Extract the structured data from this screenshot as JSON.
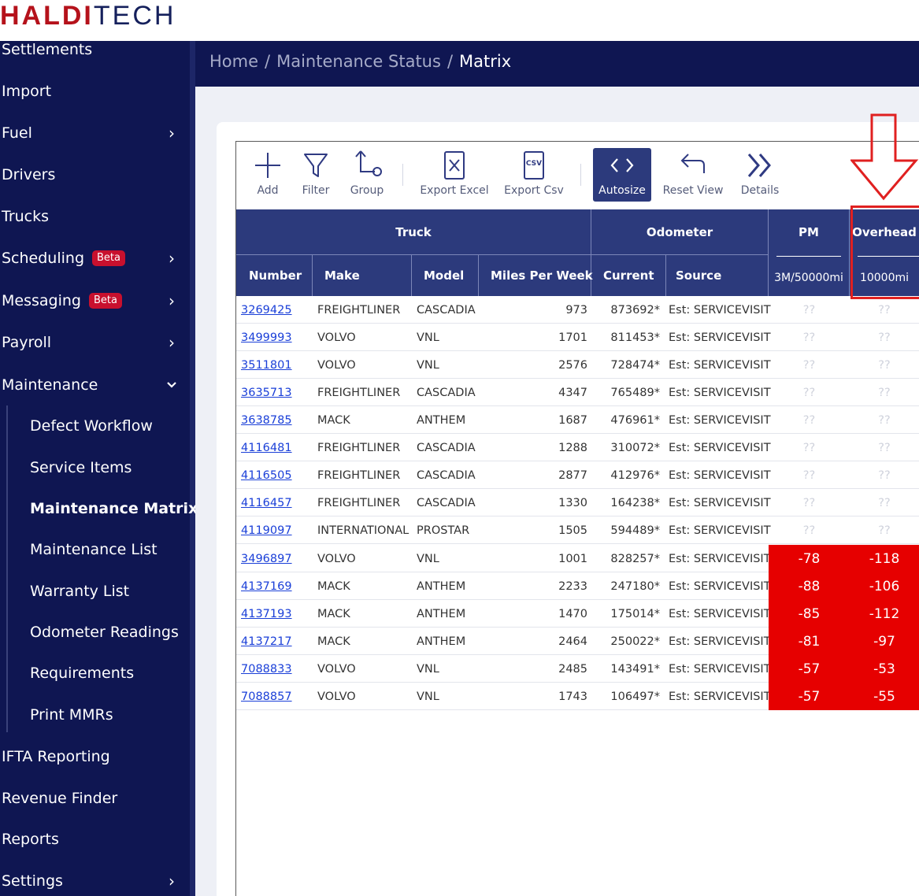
{
  "logo": {
    "part1": "HALDI",
    "part2": "TECH"
  },
  "sidebar": {
    "items": [
      {
        "label": "Settlements",
        "chevron": ""
      },
      {
        "label": "Import",
        "chevron": ""
      },
      {
        "label": "Fuel",
        "chevron": "›"
      },
      {
        "label": "Drivers",
        "chevron": ""
      },
      {
        "label": "Trucks",
        "chevron": ""
      },
      {
        "label": "Scheduling",
        "badge": "Beta",
        "chevron": "›"
      },
      {
        "label": "Messaging",
        "badge": "Beta",
        "chevron": "›"
      },
      {
        "label": "Payroll",
        "chevron": "›"
      },
      {
        "label": "Maintenance",
        "chevron": "⌄"
      }
    ],
    "sub_items": [
      {
        "label": "Defect Workflow"
      },
      {
        "label": "Service Items"
      },
      {
        "label": "Maintenance Matrix",
        "active": true
      },
      {
        "label": "Maintenance List"
      },
      {
        "label": "Warranty List"
      },
      {
        "label": "Odometer Readings"
      },
      {
        "label": "Requirements"
      },
      {
        "label": "Print MMRs"
      }
    ],
    "bottom_items": [
      {
        "label": "IFTA Reporting",
        "chevron": ""
      },
      {
        "label": "Revenue Finder",
        "chevron": ""
      },
      {
        "label": "Reports",
        "chevron": ""
      },
      {
        "label": "Settings",
        "chevron": "›"
      }
    ]
  },
  "breadcrumb": {
    "home": "Home",
    "sep": "/",
    "status": "Maintenance Status",
    "current": "Matrix"
  },
  "toolbar": {
    "add": "Add",
    "filter": "Filter",
    "group": "Group",
    "export_excel": "Export Excel",
    "export_csv": "Export Csv",
    "autosize": "Autosize",
    "reset_view": "Reset View",
    "details": "Details",
    "csv_icon_text": "CSV"
  },
  "table": {
    "groups": {
      "truck": "Truck",
      "odometer": "Odometer",
      "pm": "PM",
      "overhead": "Overhead"
    },
    "columns": {
      "number": "Number",
      "make": "Make",
      "model": "Model",
      "mpw": "Miles Per Week",
      "current": "Current",
      "source": "Source",
      "pm_sub": "3M/50000mi",
      "overhead_sub": "10000mi"
    },
    "rows": [
      {
        "number": "3269425",
        "make": "FREIGHTLINER",
        "model": "CASCADIA",
        "mpw": "973",
        "current": "873692*",
        "source": "Est: SERVICEVISIT",
        "pm": "??",
        "overhead": "??",
        "alert": false
      },
      {
        "number": "3499993",
        "make": "VOLVO",
        "model": "VNL",
        "mpw": "1701",
        "current": "811453*",
        "source": "Est: SERVICEVISIT",
        "pm": "??",
        "overhead": "??",
        "alert": false
      },
      {
        "number": "3511801",
        "make": "VOLVO",
        "model": "VNL",
        "mpw": "2576",
        "current": "728474*",
        "source": "Est: SERVICEVISIT",
        "pm": "??",
        "overhead": "??",
        "alert": false
      },
      {
        "number": "3635713",
        "make": "FREIGHTLINER",
        "model": "CASCADIA",
        "mpw": "4347",
        "current": "765489*",
        "source": "Est: SERVICEVISIT",
        "pm": "??",
        "overhead": "??",
        "alert": false
      },
      {
        "number": "3638785",
        "make": "MACK",
        "model": "ANTHEM",
        "mpw": "1687",
        "current": "476961*",
        "source": "Est: SERVICEVISIT",
        "pm": "??",
        "overhead": "??",
        "alert": false
      },
      {
        "number": "4116481",
        "make": "FREIGHTLINER",
        "model": "CASCADIA",
        "mpw": "1288",
        "current": "310072*",
        "source": "Est: SERVICEVISIT",
        "pm": "??",
        "overhead": "??",
        "alert": false
      },
      {
        "number": "4116505",
        "make": "FREIGHTLINER",
        "model": "CASCADIA",
        "mpw": "2877",
        "current": "412976*",
        "source": "Est: SERVICEVISIT",
        "pm": "??",
        "overhead": "??",
        "alert": false
      },
      {
        "number": "4116457",
        "make": "FREIGHTLINER",
        "model": "CASCADIA",
        "mpw": "1330",
        "current": "164238*",
        "source": "Est: SERVICEVISIT",
        "pm": "??",
        "overhead": "??",
        "alert": false
      },
      {
        "number": "4119097",
        "make": "INTERNATIONAL",
        "model": "PROSTAR",
        "mpw": "1505",
        "current": "594489*",
        "source": "Est: SERVICEVISIT",
        "pm": "??",
        "overhead": "??",
        "alert": false
      },
      {
        "number": "3496897",
        "make": "VOLVO",
        "model": "VNL",
        "mpw": "1001",
        "current": "828257*",
        "source": "Est: SERVICEVISIT",
        "pm": "-78",
        "overhead": "-118",
        "alert": true
      },
      {
        "number": "4137169",
        "make": "MACK",
        "model": "ANTHEM",
        "mpw": "2233",
        "current": "247180*",
        "source": "Est: SERVICEVISIT",
        "pm": "-88",
        "overhead": "-106",
        "alert": true
      },
      {
        "number": "4137193",
        "make": "MACK",
        "model": "ANTHEM",
        "mpw": "1470",
        "current": "175014*",
        "source": "Est: SERVICEVISIT",
        "pm": "-85",
        "overhead": "-112",
        "alert": true
      },
      {
        "number": "4137217",
        "make": "MACK",
        "model": "ANTHEM",
        "mpw": "2464",
        "current": "250022*",
        "source": "Est: SERVICEVISIT",
        "pm": "-81",
        "overhead": "-97",
        "alert": true
      },
      {
        "number": "7088833",
        "make": "VOLVO",
        "model": "VNL",
        "mpw": "2485",
        "current": "143491*",
        "source": "Est: SERVICEVISIT",
        "pm": "-57",
        "overhead": "-53",
        "alert": true
      },
      {
        "number": "7088857",
        "make": "VOLVO",
        "model": "VNL",
        "mpw": "1743",
        "current": "106497*",
        "source": "Est: SERVICEVISIT",
        "pm": "-57",
        "overhead": "-55",
        "alert": true
      }
    ]
  },
  "colors": {
    "nav_bg": "#0f1652",
    "header_bg": "#2c3a7c",
    "alert_red": "#e60000",
    "annotation_red": "#e02020",
    "link_blue": "#1a3fd8"
  }
}
